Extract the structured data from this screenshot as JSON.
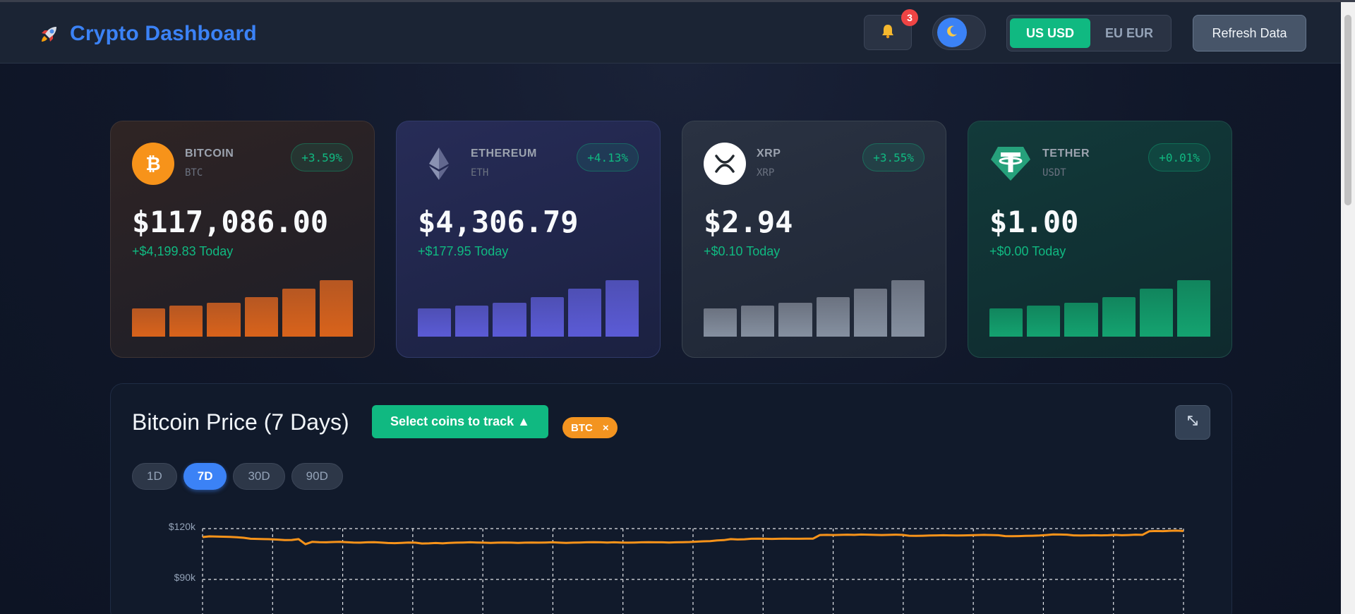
{
  "header": {
    "title": "Crypto Dashboard",
    "brand_icon": "rocket-icon",
    "notification_count": "3",
    "currencies": [
      {
        "label": "US USD",
        "active": true
      },
      {
        "label": "EU EUR",
        "active": false
      }
    ],
    "refresh_label": "Refresh Data"
  },
  "coins": [
    {
      "name": "BITCOIN",
      "symbol": "BTC",
      "change_pct": "+3.59%",
      "price": "$117,086.00",
      "today": "+$4,199.83 Today",
      "logo_color": "#f7931a",
      "bars": [
        0.5,
        0.55,
        0.6,
        0.7,
        0.85,
        1.0
      ]
    },
    {
      "name": "ETHEREUM",
      "symbol": "ETH",
      "change_pct": "+4.13%",
      "price": "$4,306.79",
      "today": "+$177.95 Today",
      "logo_color": "#627eea",
      "bars": [
        0.5,
        0.55,
        0.6,
        0.7,
        0.85,
        1.0
      ]
    },
    {
      "name": "XRP",
      "symbol": "XRP",
      "change_pct": "+3.55%",
      "price": "$2.94",
      "today": "+$0.10 Today",
      "logo_color": "#ffffff",
      "bars": [
        0.5,
        0.55,
        0.6,
        0.7,
        0.85,
        1.0
      ]
    },
    {
      "name": "TETHER",
      "symbol": "USDT",
      "change_pct": "+0.01%",
      "price": "$1.00",
      "today": "+$0.00 Today",
      "logo_color": "#26a17b",
      "bars": [
        0.5,
        0.55,
        0.6,
        0.7,
        0.85,
        1.0
      ]
    }
  ],
  "chart_panel": {
    "title": "Bitcoin Price (7 Days)",
    "select_label": "Select coins to track ▲",
    "chip_label": "BTC",
    "chip_remove": "×",
    "ranges": [
      {
        "label": "1D",
        "active": false
      },
      {
        "label": "7D",
        "active": true
      },
      {
        "label": "30D",
        "active": false
      },
      {
        "label": "90D",
        "active": false
      }
    ]
  },
  "chart_data": {
    "type": "line",
    "title": "Bitcoin Price (7 Days)",
    "yticks": [
      "$120k",
      "$90k"
    ],
    "ylim": [
      60000,
      120000
    ],
    "grid": true,
    "series": [
      {
        "color": "#f7931a",
        "values": [
          115000,
          115400,
          115300,
          115200,
          115100,
          114900,
          114600,
          114000,
          113900,
          113800,
          113700,
          113500,
          113200,
          113300,
          113800,
          110800,
          112200,
          112000,
          111900,
          112100,
          112200,
          112000,
          111800,
          111700,
          111900,
          112000,
          111800,
          111500,
          111400,
          111600,
          111800,
          111700,
          111200,
          111300,
          111500,
          111300,
          111600,
          111700,
          111800,
          111900,
          111800,
          111700,
          111600,
          111700,
          111800,
          111700,
          111600,
          111700,
          111800,
          111700,
          111800,
          111900,
          111700,
          111600,
          111700,
          111800,
          111900,
          112000,
          111900,
          111800,
          111900,
          111800,
          111700,
          111800,
          111900,
          112000,
          111900,
          111900,
          111800,
          111900,
          112000,
          112100,
          112300,
          112500,
          112600,
          113000,
          113200,
          113800,
          113600,
          113700,
          114000,
          114100,
          114000,
          113900,
          114000,
          114100,
          114000,
          114000,
          114100,
          114100,
          116200,
          116300,
          116200,
          116300,
          116400,
          116300,
          116500,
          116400,
          116300,
          116200,
          116300,
          116400,
          116300,
          115800,
          115700,
          115800,
          115900,
          116000,
          116100,
          116000,
          115900,
          116000,
          116100,
          116200,
          116300,
          116200,
          116100,
          115600,
          115500,
          115600,
          115700,
          115800,
          115900,
          116200,
          116600,
          116500,
          116400,
          116000,
          115900,
          116000,
          116100,
          116000,
          116100,
          116300,
          116100,
          116200,
          116400,
          116300,
          118400,
          118600,
          118500,
          118700,
          118800,
          118600
        ]
      }
    ]
  }
}
